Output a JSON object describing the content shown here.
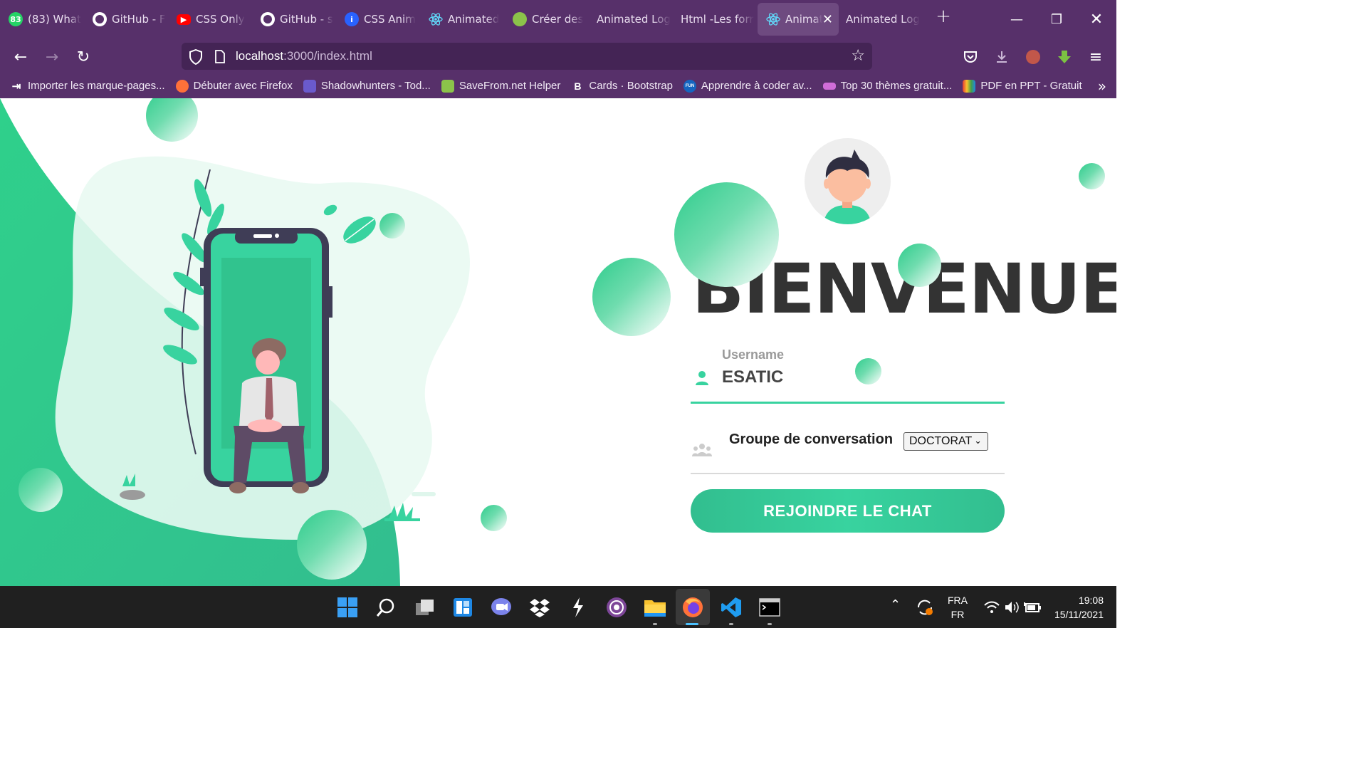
{
  "browser": {
    "tabs": [
      {
        "label": "(83) What",
        "icon": "whatsapp-icon",
        "color": "#25d366",
        "glyph": "83"
      },
      {
        "label": "GitHub - F",
        "icon": "github-icon",
        "color": "#ffffff",
        "glyph": ""
      },
      {
        "label": "CSS Only",
        "icon": "youtube-icon",
        "color": "#ff0000",
        "glyph": "▶"
      },
      {
        "label": "GitHub - s",
        "icon": "github-icon",
        "color": "#ffffff",
        "glyph": ""
      },
      {
        "label": "CSS Anim",
        "icon": "css-icon",
        "color": "#2962ff",
        "glyph": "i"
      },
      {
        "label": "Animated",
        "icon": "react-icon",
        "color": "#61dafb",
        "glyph": ""
      },
      {
        "label": "Créer des",
        "icon": "leaf-icon",
        "color": "#8bc34a",
        "glyph": ""
      },
      {
        "label": "Animated Log",
        "icon": "",
        "color": "",
        "glyph": ""
      },
      {
        "label": "Html -Les forr",
        "icon": "",
        "color": "",
        "glyph": ""
      },
      {
        "label": "Animat",
        "icon": "react-icon",
        "color": "#61dafb",
        "glyph": "",
        "active": true
      },
      {
        "label": "Animated Log",
        "icon": "",
        "color": "",
        "glyph": ""
      }
    ],
    "url_host": "localhost",
    "url_path": ":3000/index.html",
    "bookmarks": [
      {
        "label": "Importer les marque-pages...",
        "icon": "import-icon",
        "color": "#57306a"
      },
      {
        "label": "Débuter avec Firefox",
        "icon": "firefox-icon",
        "color": "#ff7139"
      },
      {
        "label": "Shadowhunters - Tod...",
        "icon": "flower-icon",
        "color": "#6a5acd"
      },
      {
        "label": "SaveFrom.net Helper",
        "icon": "download-arrow-icon",
        "color": "#8bc34a"
      },
      {
        "label": "Cards · Bootstrap",
        "icon": "bootstrap-icon",
        "color": "#57306a"
      },
      {
        "label": "Apprendre à coder av...",
        "icon": "fun-icon",
        "color": "#1565c0"
      },
      {
        "label": "Top 30 thèmes gratuit...",
        "icon": "wp-icon",
        "color": "#d06dd8"
      },
      {
        "label": "PDF en PPT - Gratuit",
        "icon": "ilovepdf-icon",
        "color": "#e53935"
      }
    ]
  },
  "login": {
    "title": "BIENVENUE",
    "username_label": "Username",
    "username_value": "ESATIC",
    "group_label": "Groupe de conversation",
    "group_selected": "DOCTORAT",
    "join_button": "REJOINDRE LE CHAT"
  },
  "colors": {
    "accent": "#38d39f",
    "browser_chrome": "#57306a",
    "phone_frame": "#3f3d56"
  },
  "taskbar": {
    "lang_top": "FRA",
    "lang_bottom": "FR",
    "time": "19:08",
    "date": "15/11/2021"
  }
}
